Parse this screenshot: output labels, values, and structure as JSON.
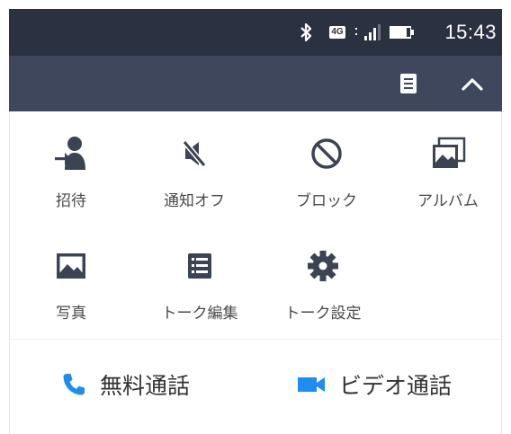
{
  "status_bar": {
    "network_type": "4G",
    "time": "15:43",
    "icons": [
      "bluetooth-icon",
      "network-type-icon",
      "signal-icon",
      "battery-icon"
    ]
  },
  "header": {
    "icons": [
      "note-icon",
      "collapse-icon"
    ]
  },
  "menu": {
    "items": [
      {
        "label": "招待",
        "icon": "invite-user-icon"
      },
      {
        "label": "通知オフ",
        "icon": "speaker-muted-icon"
      },
      {
        "label": "ブロック",
        "icon": "block-icon"
      },
      {
        "label": "アルバム",
        "icon": "album-icon"
      },
      {
        "label": "写真",
        "icon": "photo-icon"
      },
      {
        "label": "トーク編集",
        "icon": "list-edit-icon"
      },
      {
        "label": "トーク設定",
        "icon": "gear-icon"
      }
    ]
  },
  "calls": {
    "free_call": {
      "label": "無料通話",
      "icon": "phone-icon"
    },
    "video_call": {
      "label": "ビデオ通話",
      "icon": "video-camera-icon"
    }
  },
  "colors": {
    "status_bar_bg": "#2a3242",
    "header_bg": "#3e475b",
    "icon_dark": "#3c4352",
    "accent_blue": "#1e8cf0"
  }
}
